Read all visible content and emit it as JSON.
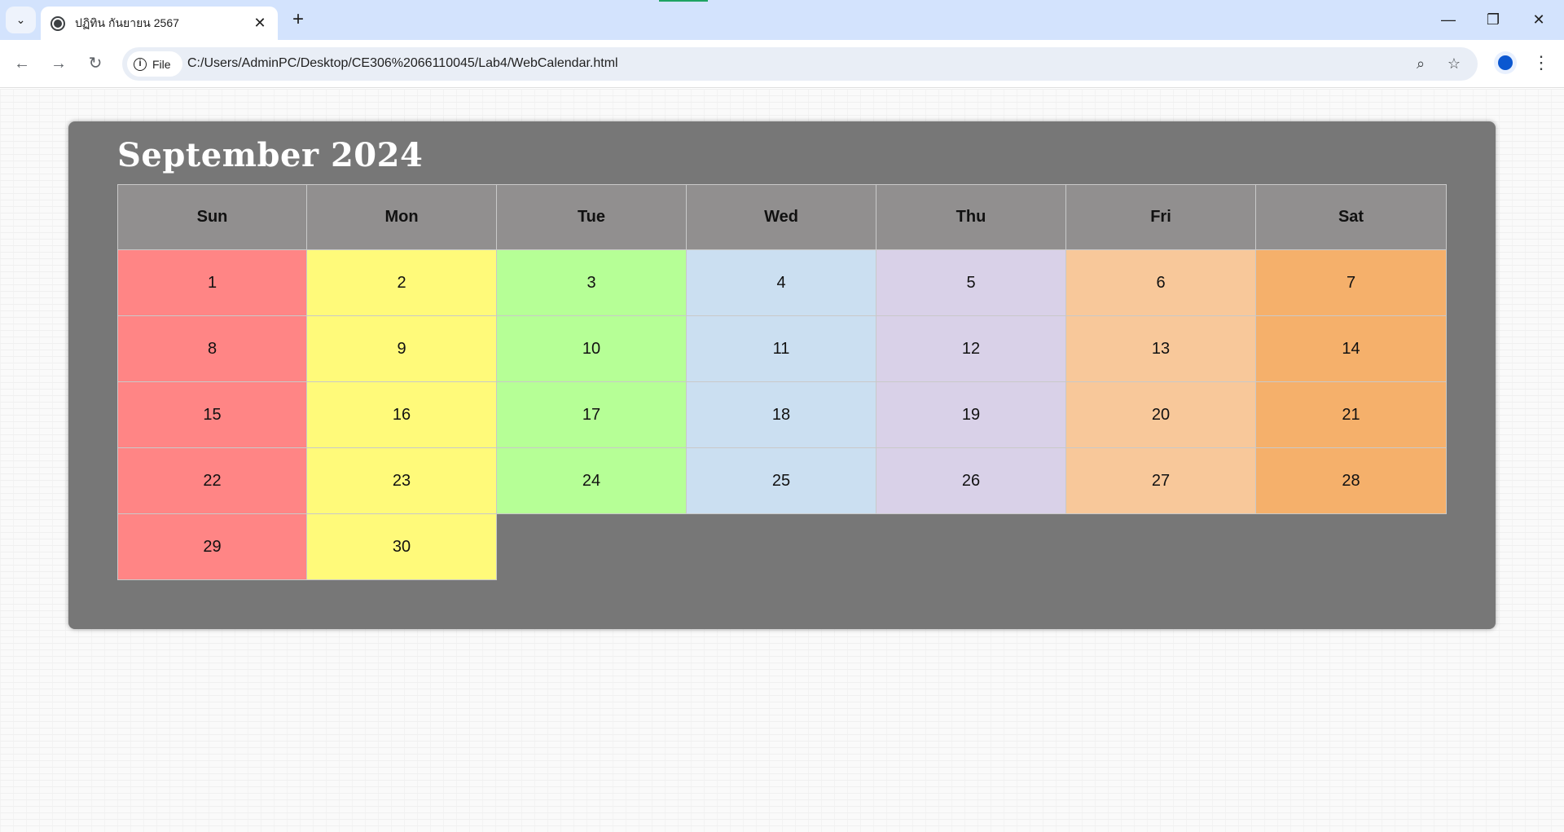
{
  "browser": {
    "tab_title": "ปฏิทิน กันยายน 2567",
    "url": "C:/Users/AdminPC/Desktop/CE306%2066110045/Lab4/WebCalendar.html",
    "site_chip_label": "File",
    "icons": {
      "tab_search": "chevron-down-icon",
      "favicon": "globe-icon",
      "close": "close-icon",
      "new_tab": "plus-icon",
      "back": "back-arrow-icon",
      "forward": "forward-arrow-icon",
      "reload": "reload-icon",
      "zoom": "zoom-icon",
      "bookmark": "star-icon",
      "profile": "profile-icon",
      "menu": "kebab-menu-icon"
    }
  },
  "calendar": {
    "title": "September 2024",
    "weekdays": [
      "Sun",
      "Mon",
      "Tue",
      "Wed",
      "Thu",
      "Fri",
      "Sat"
    ],
    "weekday_colors": [
      "#ff8585",
      "#fffa7a",
      "#b6ff96",
      "#cbdff1",
      "#d9d1e8",
      "#f8c89a",
      "#f5b06b"
    ],
    "weeks": [
      [
        "1",
        "2",
        "3",
        "4",
        "5",
        "6",
        "7"
      ],
      [
        "8",
        "9",
        "10",
        "11",
        "12",
        "13",
        "14"
      ],
      [
        "15",
        "16",
        "17",
        "18",
        "19",
        "20",
        "21"
      ],
      [
        "22",
        "23",
        "24",
        "25",
        "26",
        "27",
        "28"
      ],
      [
        "29",
        "30"
      ]
    ],
    "colors": {
      "panel": "#777777",
      "header": "#918f8f"
    }
  }
}
